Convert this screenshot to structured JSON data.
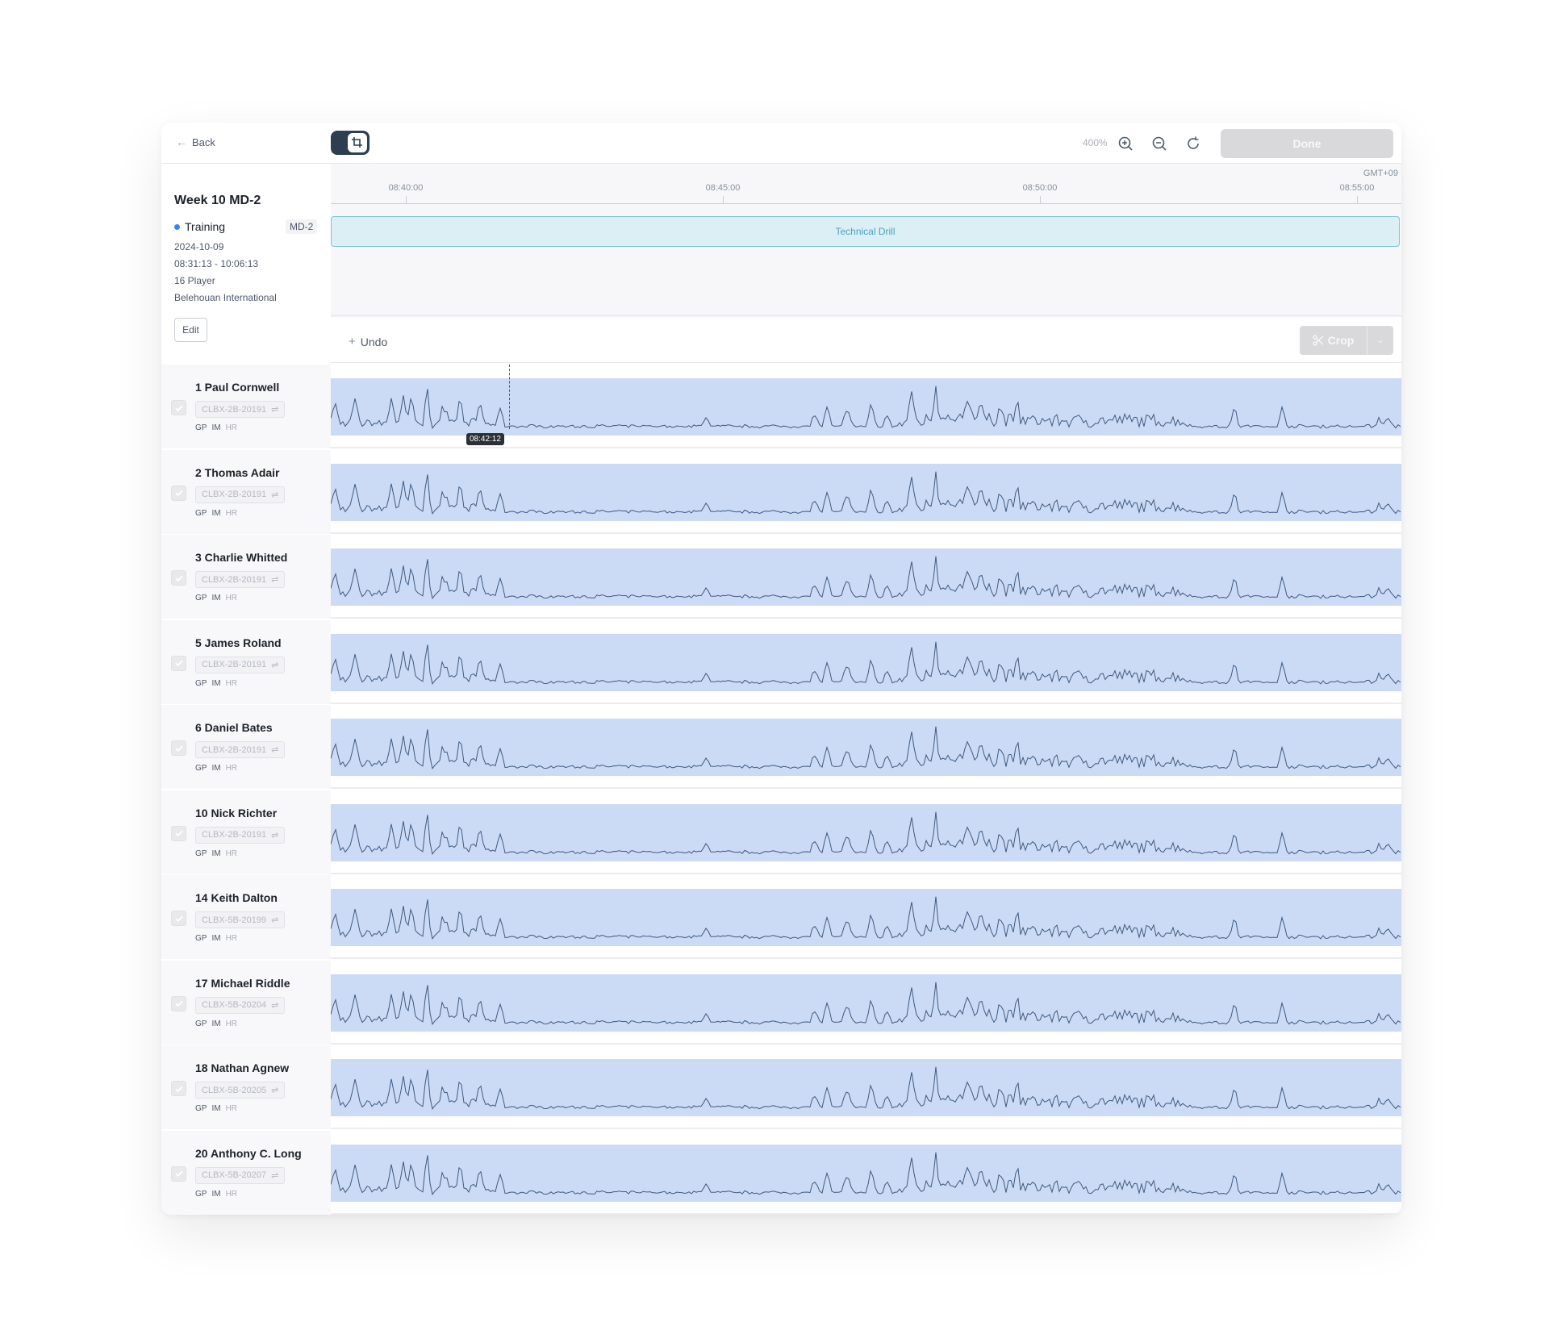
{
  "header": {
    "back_label": "Back",
    "zoom_level": "400%",
    "done_label": "Done"
  },
  "session": {
    "title": "Week 10 MD-2",
    "type": "Training",
    "tag": "MD-2",
    "date": "2024-10-09",
    "time_range": "08:31:13 - 10:06:13",
    "players_count": "16 Player",
    "venue": "Belehouan International",
    "edit_label": "Edit"
  },
  "timeline": {
    "timezone": "GMT+09",
    "ticks": [
      "08:40:00",
      "08:45:00",
      "08:50:00",
      "08:55:00"
    ],
    "phase_label": "Technical Drill"
  },
  "toolbar": {
    "undo_label": "Undo",
    "crop_label": "Crop"
  },
  "cursor": {
    "time": "08:42:12"
  },
  "sensor_labels": [
    "GP",
    "IM",
    "HR"
  ],
  "players": [
    {
      "name": "1 Paul Cornwell",
      "device": "CLBX-2B-20191"
    },
    {
      "name": "2 Thomas Adair",
      "device": "CLBX-2B-20191"
    },
    {
      "name": "3 Charlie Whitted",
      "device": "CLBX-2B-20191"
    },
    {
      "name": "5 James Roland",
      "device": "CLBX-2B-20191"
    },
    {
      "name": "6 Daniel Bates",
      "device": "CLBX-2B-20191"
    },
    {
      "name": "10 Nick Richter",
      "device": "CLBX-2B-20191"
    },
    {
      "name": "14 Keith Dalton",
      "device": "CLBX-5B-20199"
    },
    {
      "name": "17 Michael Riddle",
      "device": "CLBX-5B-20204"
    },
    {
      "name": "18 Nathan Agnew",
      "device": "CLBX-5B-20205"
    },
    {
      "name": "20 Anthony C. Long",
      "device": "CLBX-5B-20207"
    }
  ],
  "colors": {
    "accent": "#2c3e50",
    "signal_fill": "#ccdbf5",
    "signal_line": "#3d5a80",
    "phase_fill": "#dbeff5",
    "phase_border": "#7cc4d9"
  }
}
